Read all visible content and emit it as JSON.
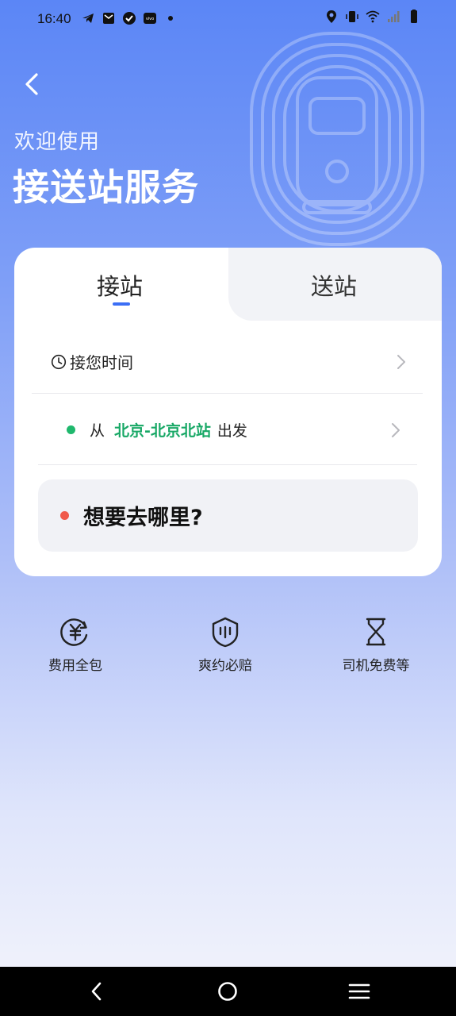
{
  "status_bar": {
    "time": "16:40",
    "left_icons": [
      "telegram-icon",
      "mail-icon",
      "check-badge-icon",
      "vivo-icon",
      "dot-icon"
    ],
    "right_icons": [
      "location-icon",
      "vibrate-icon",
      "wifi-icon",
      "signal-icon",
      "battery-icon"
    ]
  },
  "header": {
    "back_icon": "chevron-left-icon",
    "subtitle": "欢迎使用",
    "title": "接送站服务"
  },
  "tabs": [
    {
      "label": "接站",
      "active": true
    },
    {
      "label": "送站",
      "active": false
    }
  ],
  "pickup_time": {
    "icon": "clock-icon",
    "label": "接您时间"
  },
  "origin": {
    "prefix": "从",
    "station": "北京-北京北站",
    "suffix": "出发"
  },
  "destination": {
    "placeholder": "想要去哪里?"
  },
  "features": [
    {
      "icon": "yuan-icon",
      "label": "费用全包"
    },
    {
      "icon": "shield-icon",
      "label": "爽约必赔"
    },
    {
      "icon": "hourglass-icon",
      "label": "司机免费等"
    }
  ],
  "colors": {
    "accent": "#3b6ef5",
    "origin_green": "#18a866",
    "destination_red": "#f05a4b"
  },
  "nav_bar": [
    "back-icon",
    "home-icon",
    "menu-icon"
  ]
}
